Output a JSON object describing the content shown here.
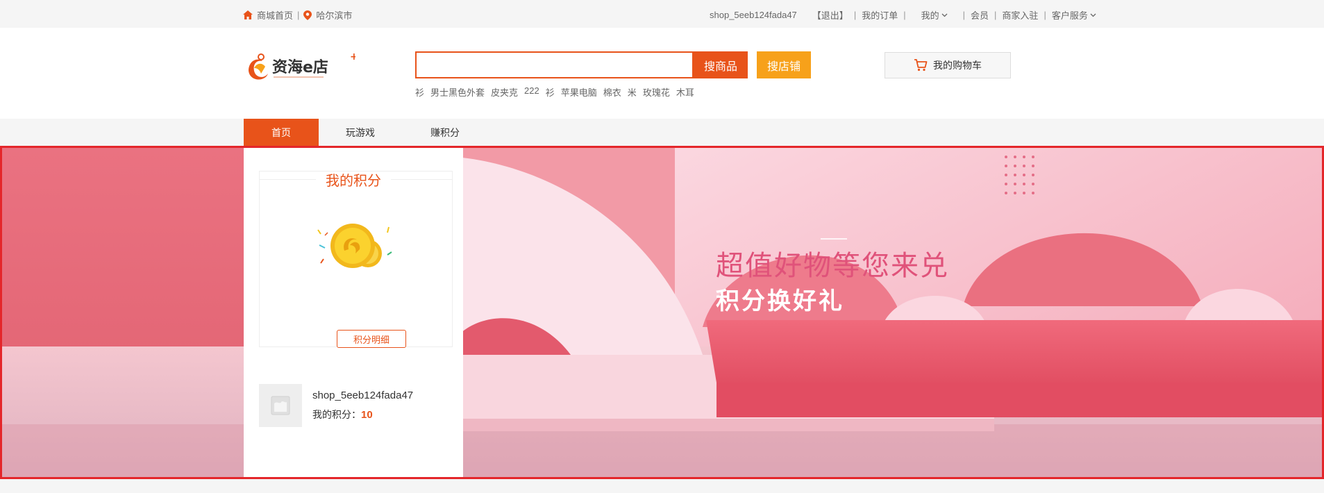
{
  "topbar": {
    "home_label": "商城首页",
    "city_label": "哈尔滨市",
    "username": "shop_5eeb124fada47",
    "logout": "【退出】",
    "orders": "我的订单",
    "mine": "我的",
    "member": "会员",
    "merchant": "商家入驻",
    "service": "客户服务"
  },
  "header": {
    "logo_text": "资海e店",
    "search_placeholder": "",
    "search_goods": "搜商品",
    "search_shop": "搜店铺",
    "hot_keywords": [
      "衫",
      "男士黑色外套",
      "皮夹克",
      "222",
      "衫",
      "苹果电脑",
      "棉衣",
      "米",
      "玫瑰花",
      "木耳"
    ],
    "cart_label": "我的购物车"
  },
  "nav": {
    "items": [
      "首页",
      "玩游戏",
      "赚积分"
    ]
  },
  "panel": {
    "title": "我的积分",
    "detail_button": "积分明细",
    "username": "shop_5eeb124fada47",
    "points_label": "我的积分：",
    "points_value": "10"
  },
  "banner": {
    "headline": "超值好物等您来兑",
    "subheadline": "积分换好礼"
  },
  "colors": {
    "brand": "#e8531a",
    "shop_button": "#f7a11a",
    "banner_pink": "#e46d7c"
  }
}
